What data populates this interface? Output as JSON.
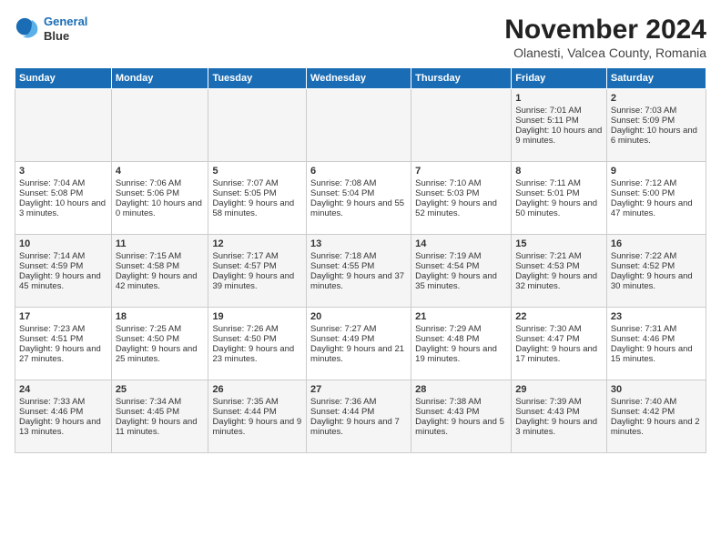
{
  "header": {
    "logo_line1": "General",
    "logo_line2": "Blue",
    "main_title": "November 2024",
    "subtitle": "Olanesti, Valcea County, Romania"
  },
  "calendar": {
    "days_of_week": [
      "Sunday",
      "Monday",
      "Tuesday",
      "Wednesday",
      "Thursday",
      "Friday",
      "Saturday"
    ],
    "weeks": [
      [
        {
          "day": "",
          "info": ""
        },
        {
          "day": "",
          "info": ""
        },
        {
          "day": "",
          "info": ""
        },
        {
          "day": "",
          "info": ""
        },
        {
          "day": "",
          "info": ""
        },
        {
          "day": "1",
          "info": "Sunrise: 7:01 AM\nSunset: 5:11 PM\nDaylight: 10 hours and 9 minutes."
        },
        {
          "day": "2",
          "info": "Sunrise: 7:03 AM\nSunset: 5:09 PM\nDaylight: 10 hours and 6 minutes."
        }
      ],
      [
        {
          "day": "3",
          "info": "Sunrise: 7:04 AM\nSunset: 5:08 PM\nDaylight: 10 hours and 3 minutes."
        },
        {
          "day": "4",
          "info": "Sunrise: 7:06 AM\nSunset: 5:06 PM\nDaylight: 10 hours and 0 minutes."
        },
        {
          "day": "5",
          "info": "Sunrise: 7:07 AM\nSunset: 5:05 PM\nDaylight: 9 hours and 58 minutes."
        },
        {
          "day": "6",
          "info": "Sunrise: 7:08 AM\nSunset: 5:04 PM\nDaylight: 9 hours and 55 minutes."
        },
        {
          "day": "7",
          "info": "Sunrise: 7:10 AM\nSunset: 5:03 PM\nDaylight: 9 hours and 52 minutes."
        },
        {
          "day": "8",
          "info": "Sunrise: 7:11 AM\nSunset: 5:01 PM\nDaylight: 9 hours and 50 minutes."
        },
        {
          "day": "9",
          "info": "Sunrise: 7:12 AM\nSunset: 5:00 PM\nDaylight: 9 hours and 47 minutes."
        }
      ],
      [
        {
          "day": "10",
          "info": "Sunrise: 7:14 AM\nSunset: 4:59 PM\nDaylight: 9 hours and 45 minutes."
        },
        {
          "day": "11",
          "info": "Sunrise: 7:15 AM\nSunset: 4:58 PM\nDaylight: 9 hours and 42 minutes."
        },
        {
          "day": "12",
          "info": "Sunrise: 7:17 AM\nSunset: 4:57 PM\nDaylight: 9 hours and 39 minutes."
        },
        {
          "day": "13",
          "info": "Sunrise: 7:18 AM\nSunset: 4:55 PM\nDaylight: 9 hours and 37 minutes."
        },
        {
          "day": "14",
          "info": "Sunrise: 7:19 AM\nSunset: 4:54 PM\nDaylight: 9 hours and 35 minutes."
        },
        {
          "day": "15",
          "info": "Sunrise: 7:21 AM\nSunset: 4:53 PM\nDaylight: 9 hours and 32 minutes."
        },
        {
          "day": "16",
          "info": "Sunrise: 7:22 AM\nSunset: 4:52 PM\nDaylight: 9 hours and 30 minutes."
        }
      ],
      [
        {
          "day": "17",
          "info": "Sunrise: 7:23 AM\nSunset: 4:51 PM\nDaylight: 9 hours and 27 minutes."
        },
        {
          "day": "18",
          "info": "Sunrise: 7:25 AM\nSunset: 4:50 PM\nDaylight: 9 hours and 25 minutes."
        },
        {
          "day": "19",
          "info": "Sunrise: 7:26 AM\nSunset: 4:50 PM\nDaylight: 9 hours and 23 minutes."
        },
        {
          "day": "20",
          "info": "Sunrise: 7:27 AM\nSunset: 4:49 PM\nDaylight: 9 hours and 21 minutes."
        },
        {
          "day": "21",
          "info": "Sunrise: 7:29 AM\nSunset: 4:48 PM\nDaylight: 9 hours and 19 minutes."
        },
        {
          "day": "22",
          "info": "Sunrise: 7:30 AM\nSunset: 4:47 PM\nDaylight: 9 hours and 17 minutes."
        },
        {
          "day": "23",
          "info": "Sunrise: 7:31 AM\nSunset: 4:46 PM\nDaylight: 9 hours and 15 minutes."
        }
      ],
      [
        {
          "day": "24",
          "info": "Sunrise: 7:33 AM\nSunset: 4:46 PM\nDaylight: 9 hours and 13 minutes."
        },
        {
          "day": "25",
          "info": "Sunrise: 7:34 AM\nSunset: 4:45 PM\nDaylight: 9 hours and 11 minutes."
        },
        {
          "day": "26",
          "info": "Sunrise: 7:35 AM\nSunset: 4:44 PM\nDaylight: 9 hours and 9 minutes."
        },
        {
          "day": "27",
          "info": "Sunrise: 7:36 AM\nSunset: 4:44 PM\nDaylight: 9 hours and 7 minutes."
        },
        {
          "day": "28",
          "info": "Sunrise: 7:38 AM\nSunset: 4:43 PM\nDaylight: 9 hours and 5 minutes."
        },
        {
          "day": "29",
          "info": "Sunrise: 7:39 AM\nSunset: 4:43 PM\nDaylight: 9 hours and 3 minutes."
        },
        {
          "day": "30",
          "info": "Sunrise: 7:40 AM\nSunset: 4:42 PM\nDaylight: 9 hours and 2 minutes."
        }
      ]
    ]
  }
}
